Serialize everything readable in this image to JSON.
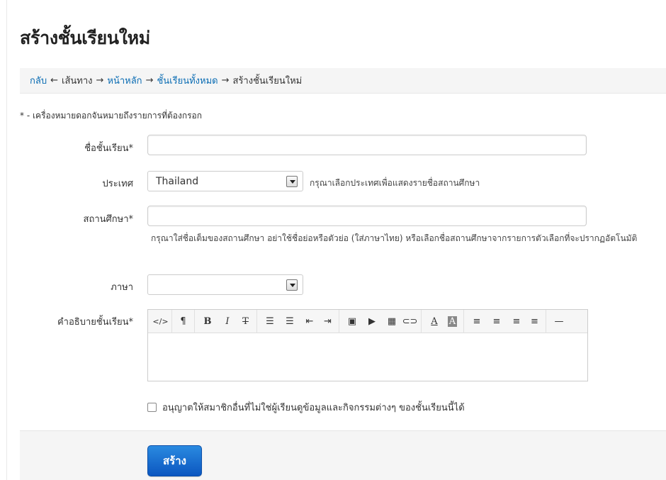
{
  "page": {
    "title": "สร้างชั้นเรียนใหม่"
  },
  "breadcrumb": {
    "back": "กลับ",
    "path_label": "เส้นทาง",
    "home": "หน้าหลัก",
    "all_classes": "ชั้นเรียนทั้งหมด",
    "current": "สร้างชั้นเรียนใหม่"
  },
  "form": {
    "required_note": "* - เครื่องหมายดอกจันหมายถึงรายการที่ต้องกรอก",
    "class_name": {
      "label": "ชื่อชั้นเรียน",
      "req": "*",
      "value": ""
    },
    "country": {
      "label": "ประเทศ",
      "selected": "Thailand",
      "help": "กรุณาเลือกประเทศเพื่อแสดงรายชื่อสถานศึกษา"
    },
    "school": {
      "label": "สถานศึกษา",
      "req": "*",
      "value": "",
      "help": "กรุณาใส่ชื่อเต็มของสถานศึกษา อย่าใช้ชื่อย่อหรือตัวย่อ (ใส่ภาษาไทย) หรือเลือกชื่อสถานศึกษาจากรายการตัวเลือกที่จะปรากฏอัตโนมัติ"
    },
    "language": {
      "label": "ภาษา",
      "selected": ""
    },
    "description": {
      "label": "คำอธิบายชั้นเรียน",
      "req": "*"
    },
    "allow_view": {
      "label": "อนุญาตให้สมาชิกอื่นที่ไม่ใช่ผู้เรียนดูข้อมูลและกิจกรรมต่างๆ ของชั้นเรียนนี้ได้",
      "checked": false
    },
    "submit_label": "สร้าง"
  },
  "toolbar_icons": [
    "code-view-icon",
    "paragraph-icon",
    "bold-icon",
    "italic-icon",
    "strikethrough-icon",
    "unordered-list-icon",
    "ordered-list-icon",
    "outdent-icon",
    "indent-icon",
    "image-icon",
    "video-icon",
    "table-icon",
    "link-icon",
    "font-color-icon",
    "background-color-icon",
    "align-left-icon",
    "align-center-icon",
    "align-right-icon",
    "justify-icon",
    "horizontal-rule-icon"
  ]
}
